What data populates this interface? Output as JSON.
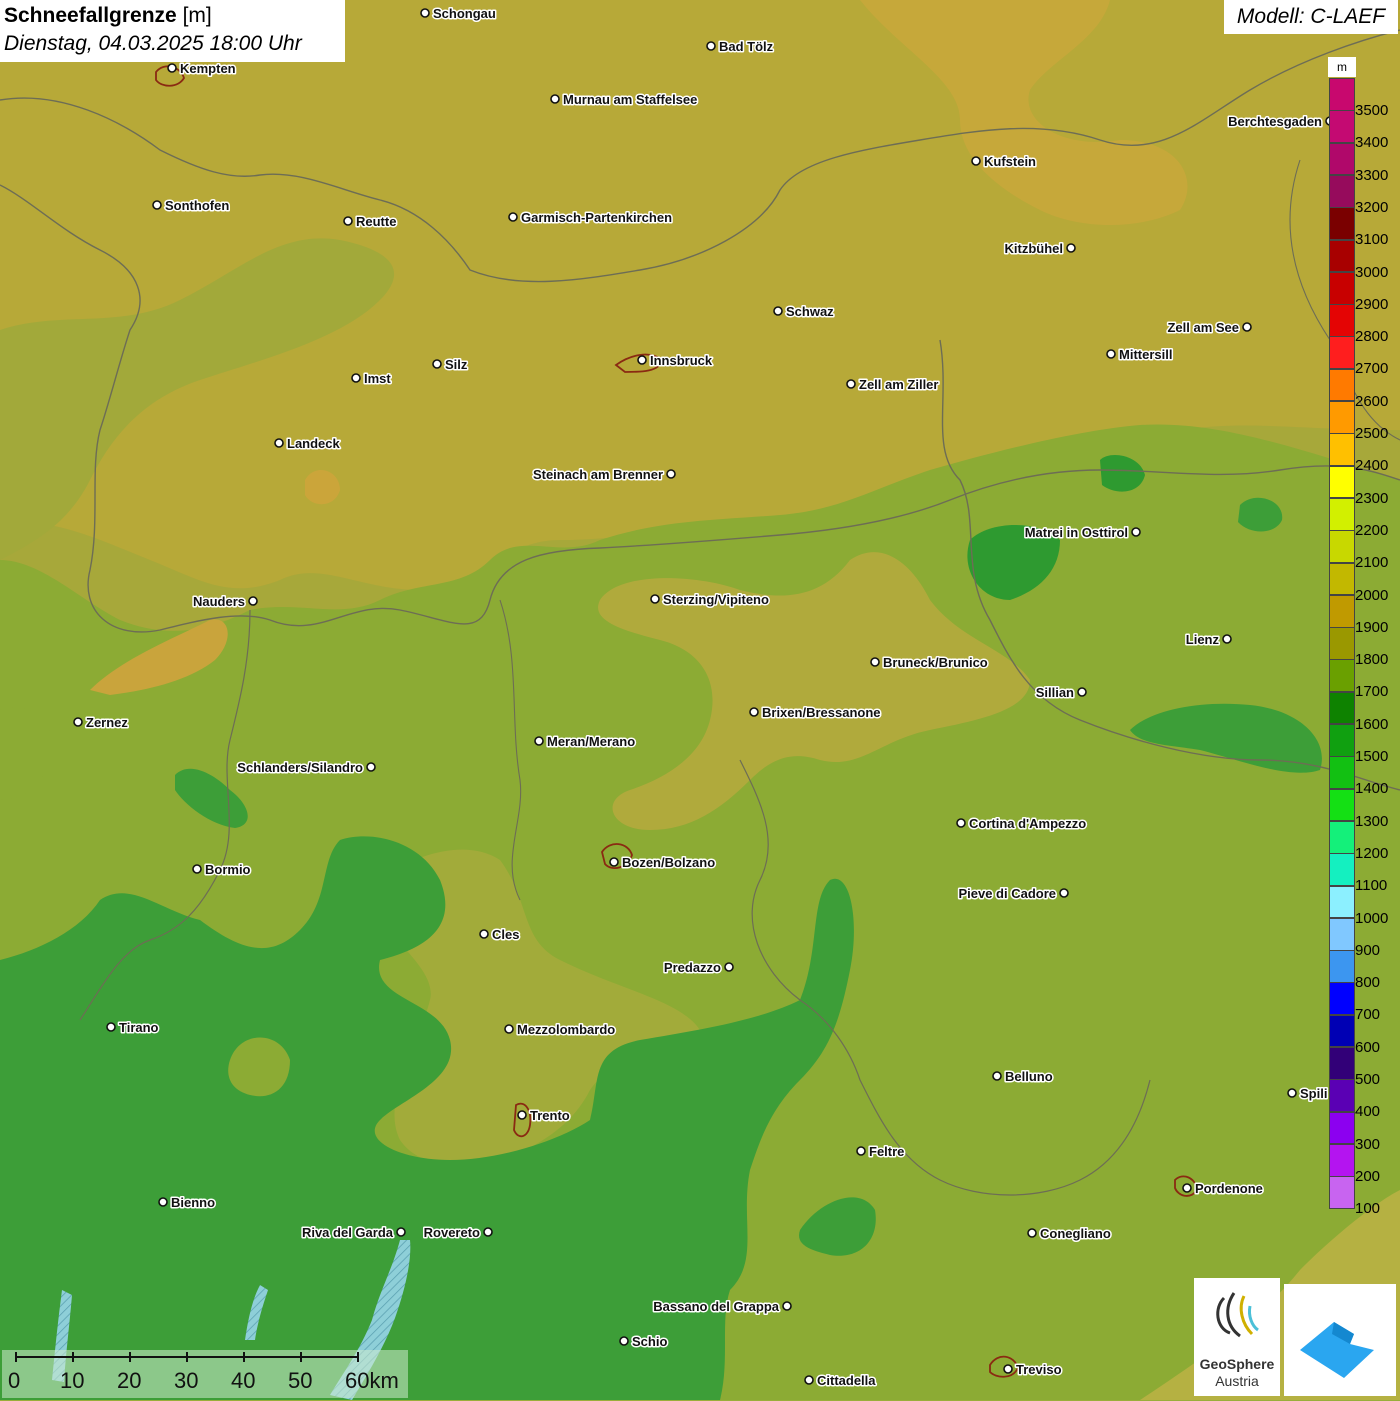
{
  "title": {
    "main": "Schneefallgrenze",
    "unit": "[m]",
    "datetime": "Dienstag, 04.03.2025 18:00 Uhr"
  },
  "model": "Modell: C-LAEF",
  "legend": {
    "unit": "m",
    "entries": [
      {
        "label": "3500",
        "color": "#c8086e"
      },
      {
        "label": "3400",
        "color": "#c40a72"
      },
      {
        "label": "3300",
        "color": "#b0086a"
      },
      {
        "label": "3200",
        "color": "#960b5c"
      },
      {
        "label": "3100",
        "color": "#7a0000"
      },
      {
        "label": "3000",
        "color": "#a80000"
      },
      {
        "label": "2900",
        "color": "#c80000"
      },
      {
        "label": "2800",
        "color": "#e40404"
      },
      {
        "label": "2700",
        "color": "#ff1e1e"
      },
      {
        "label": "2600",
        "color": "#ff7a00"
      },
      {
        "label": "2500",
        "color": "#ff9a00"
      },
      {
        "label": "2400",
        "color": "#ffc000"
      },
      {
        "label": "2300",
        "color": "#ffff00"
      },
      {
        "label": "2200",
        "color": "#d2f000"
      },
      {
        "label": "2100",
        "color": "#c8d800"
      },
      {
        "label": "2000",
        "color": "#c2b800"
      },
      {
        "label": "1900",
        "color": "#c09a00"
      },
      {
        "label": "1800",
        "color": "#9a9800"
      },
      {
        "label": "1700",
        "color": "#6aa000"
      },
      {
        "label": "1600",
        "color": "#0e8200"
      },
      {
        "label": "1500",
        "color": "#10a010"
      },
      {
        "label": "1400",
        "color": "#12c012"
      },
      {
        "label": "1300",
        "color": "#14e014"
      },
      {
        "label": "1200",
        "color": "#14f07a"
      },
      {
        "label": "1100",
        "color": "#14f0c0"
      },
      {
        "label": "1000",
        "color": "#8cf0ff"
      },
      {
        "label": "900",
        "color": "#80c8ff"
      },
      {
        "label": "800",
        "color": "#3c96f0"
      },
      {
        "label": "700",
        "color": "#0000ff"
      },
      {
        "label": "600",
        "color": "#0000b4"
      },
      {
        "label": "500",
        "color": "#320078"
      },
      {
        "label": "400",
        "color": "#5a00b4"
      },
      {
        "label": "300",
        "color": "#8c00f0"
      },
      {
        "label": "200",
        "color": "#b414f0"
      },
      {
        "label": "100",
        "color": "#c864f0"
      }
    ]
  },
  "cities": [
    {
      "name": "Schongau",
      "dot": "left"
    },
    {
      "name": "Bad Tölz",
      "dot": "left"
    },
    {
      "name": "Kempten",
      "dot": "left"
    },
    {
      "name": "Murnau am Staffelsee",
      "dot": "left"
    },
    {
      "name": "Berchtesgaden",
      "dot": "right"
    },
    {
      "name": "Kufstein",
      "dot": "left"
    },
    {
      "name": "Sonthofen",
      "dot": "left"
    },
    {
      "name": "Reutte",
      "dot": "left"
    },
    {
      "name": "Garmisch-Partenkirchen",
      "dot": "left"
    },
    {
      "name": "Kitzbühel",
      "dot": "right"
    },
    {
      "name": "Schwaz",
      "dot": "left"
    },
    {
      "name": "Zell am See",
      "dot": "right"
    },
    {
      "name": "Innsbruck",
      "dot": "left"
    },
    {
      "name": "Mittersill",
      "dot": "left"
    },
    {
      "name": "Imst",
      "dot": "left"
    },
    {
      "name": "Silz",
      "dot": "left"
    },
    {
      "name": "Zell am Ziller",
      "dot": "left"
    },
    {
      "name": "Landeck",
      "dot": "left"
    },
    {
      "name": "Steinach am Brenner",
      "dot": "right"
    },
    {
      "name": "Matrei in Osttirol",
      "dot": "right"
    },
    {
      "name": "Nauders",
      "dot": "right"
    },
    {
      "name": "Sterzing/Vipiteno",
      "dot": "left"
    },
    {
      "name": "Lienz",
      "dot": "right"
    },
    {
      "name": "Bruneck/Brunico",
      "dot": "left"
    },
    {
      "name": "Sillian",
      "dot": "right"
    },
    {
      "name": "Zernez",
      "dot": "left"
    },
    {
      "name": "Brixen/Bressanone",
      "dot": "left"
    },
    {
      "name": "Meran/Merano",
      "dot": "left"
    },
    {
      "name": "Schlanders/Silandro",
      "dot": "right"
    },
    {
      "name": "Cortina d'Ampezzo",
      "dot": "left"
    },
    {
      "name": "Bozen/Bolzano",
      "dot": "left"
    },
    {
      "name": "Bormio",
      "dot": "left"
    },
    {
      "name": "Pieve di Cadore",
      "dot": "right"
    },
    {
      "name": "Cles",
      "dot": "left"
    },
    {
      "name": "Predazzo",
      "dot": "right"
    },
    {
      "name": "Tirano",
      "dot": "left"
    },
    {
      "name": "Mezzolombardo",
      "dot": "left"
    },
    {
      "name": "Belluno",
      "dot": "left"
    },
    {
      "name": "Spili",
      "dot": "left"
    },
    {
      "name": "Trento",
      "dot": "left"
    },
    {
      "name": "Feltre",
      "dot": "left"
    },
    {
      "name": "Pordenone",
      "dot": "left"
    },
    {
      "name": "Bienno",
      "dot": "left"
    },
    {
      "name": "Riva del Garda",
      "dot": "right"
    },
    {
      "name": "Rovereto",
      "dot": "right"
    },
    {
      "name": "Conegliano",
      "dot": "left"
    },
    {
      "name": "Bassano del Grappa",
      "dot": "right"
    },
    {
      "name": "Schio",
      "dot": "left"
    },
    {
      "name": "Treviso",
      "dot": "left"
    },
    {
      "name": "Cittadella",
      "dot": "left"
    }
  ],
  "scale_bar": {
    "labels": [
      "0",
      "10",
      "20",
      "30",
      "40",
      "50",
      "60km"
    ]
  },
  "logos": {
    "geosphere_line1": "GeoSphere",
    "geosphere_line2": "Austria"
  },
  "colors": {
    "band_1500_1600": "#2e9a30",
    "band_1700": "#6aa628",
    "band_1800": "#9aae3a",
    "band_1900": "#c6aa36"
  }
}
